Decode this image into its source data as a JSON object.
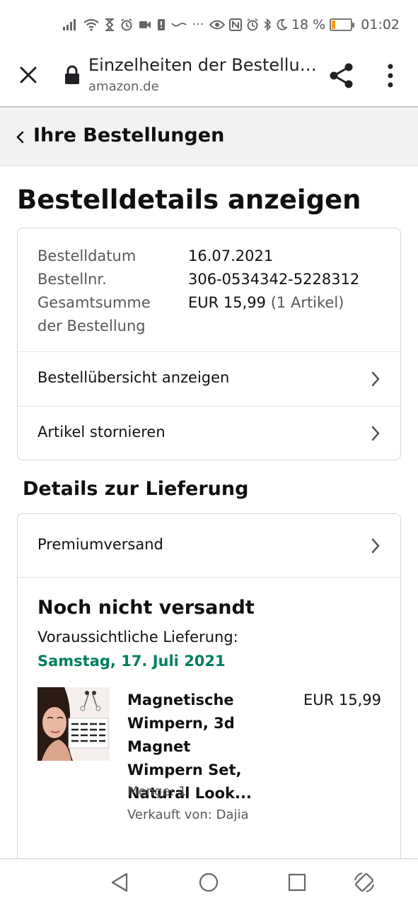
{
  "status_bar": {
    "battery_percent": "18 %",
    "battery_level": 0.18,
    "time": "01:02",
    "overflow_dots": "···",
    "icons_left": [
      "signal-icon",
      "wifi-icon",
      "hourglass-icon",
      "alarm-icon",
      "video-icon",
      "sim-alert-icon",
      "squiggle-icon"
    ],
    "icons_right": [
      "eye-icon",
      "nfc-icon",
      "alarm-icon",
      "bluetooth-icon",
      "moon-icon",
      "battery-icon"
    ]
  },
  "browser": {
    "page_title": "Einzelheiten der Bestellu…",
    "domain": "amazon.de",
    "icons": [
      "close-icon",
      "lock-icon",
      "share-icon",
      "more-vert-icon"
    ]
  },
  "nav": {
    "back_label": "Ihre Bestellungen"
  },
  "page": {
    "title": "Bestelldetails anzeigen"
  },
  "order": {
    "date_label": "Bestelldatum",
    "date_value": "16.07.2021",
    "number_label": "Bestellnr.",
    "number_value": "306-0534342-5228312",
    "total_label_line1": "Gesamtsumme",
    "total_label_line2": "der Bestellung",
    "total_value": "EUR 15,99",
    "total_count": "(1 Artikel)",
    "overview_link": "Bestellübersicht anzeigen",
    "cancel_link": "Artikel stornieren"
  },
  "delivery": {
    "section_title": "Details zur Lieferung",
    "shipping_method": "Premiumversand",
    "status": "Noch nicht versandt",
    "estimate_label": "Voraussichtliche Lieferung:",
    "estimate_date": "Samstag, 17. Juli 2021",
    "estimate_color": "#007f61"
  },
  "product": {
    "title_lines": [
      "Magnetische",
      "Wimpern, 3d Magnet",
      "Wimpern Set,",
      "Natural Look..."
    ],
    "price": "EUR 15,99",
    "quantity": "Menge: 1",
    "seller": "Verkauft von: Dajia"
  },
  "system_nav": {
    "icons": [
      "back-triangle-icon",
      "home-circle-icon",
      "recents-square-icon",
      "rotate-icon"
    ]
  }
}
